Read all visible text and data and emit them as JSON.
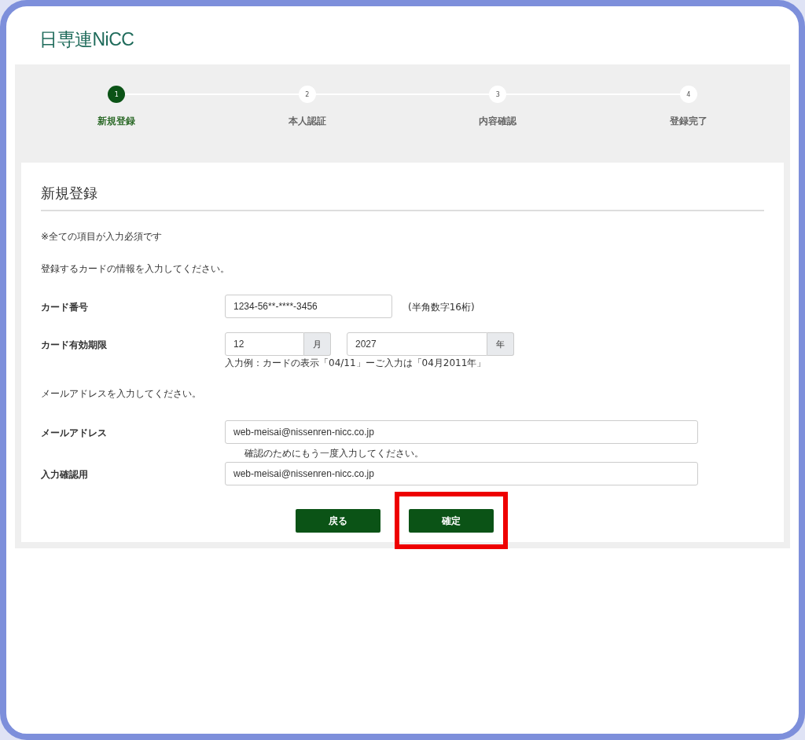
{
  "logo": "日専連NiCC",
  "steps": [
    {
      "number": "1",
      "label": "新規登録",
      "selected": true
    },
    {
      "number": "2",
      "label": "本人認証",
      "selected": false
    },
    {
      "number": "3",
      "label": "内容確認",
      "selected": false
    },
    {
      "number": "4",
      "label": "登録完了",
      "selected": false
    }
  ],
  "title": "新規登録",
  "required_note": "※全ての項目が入力必須です",
  "card_intro": "登録するカードの情報を入力してください。",
  "card_number": {
    "label": "カード番号",
    "value": "1234-56**-****-3456",
    "hint": "(半角数字16桁)"
  },
  "expiry": {
    "label": "カード有効期限",
    "month": "12",
    "month_unit": "月",
    "year": "2027",
    "year_unit": "年",
    "example": "入力例：カードの表示「04/11」ーご入力は「04月2011年」"
  },
  "email_intro": "メールアドレスを入力してください。",
  "email": {
    "label": "メールアドレス",
    "value": "web-meisai@nissenren-nicc.co.jp"
  },
  "confirm_note": "確認のためにもう一度入力してください。",
  "email_confirm": {
    "label": "入力確認用",
    "value": "web-meisai@nissenren-nicc.co.jp"
  },
  "buttons": [
    {
      "label": "戻る",
      "highlighted": false
    },
    {
      "label": "確定",
      "highlighted": true
    }
  ]
}
